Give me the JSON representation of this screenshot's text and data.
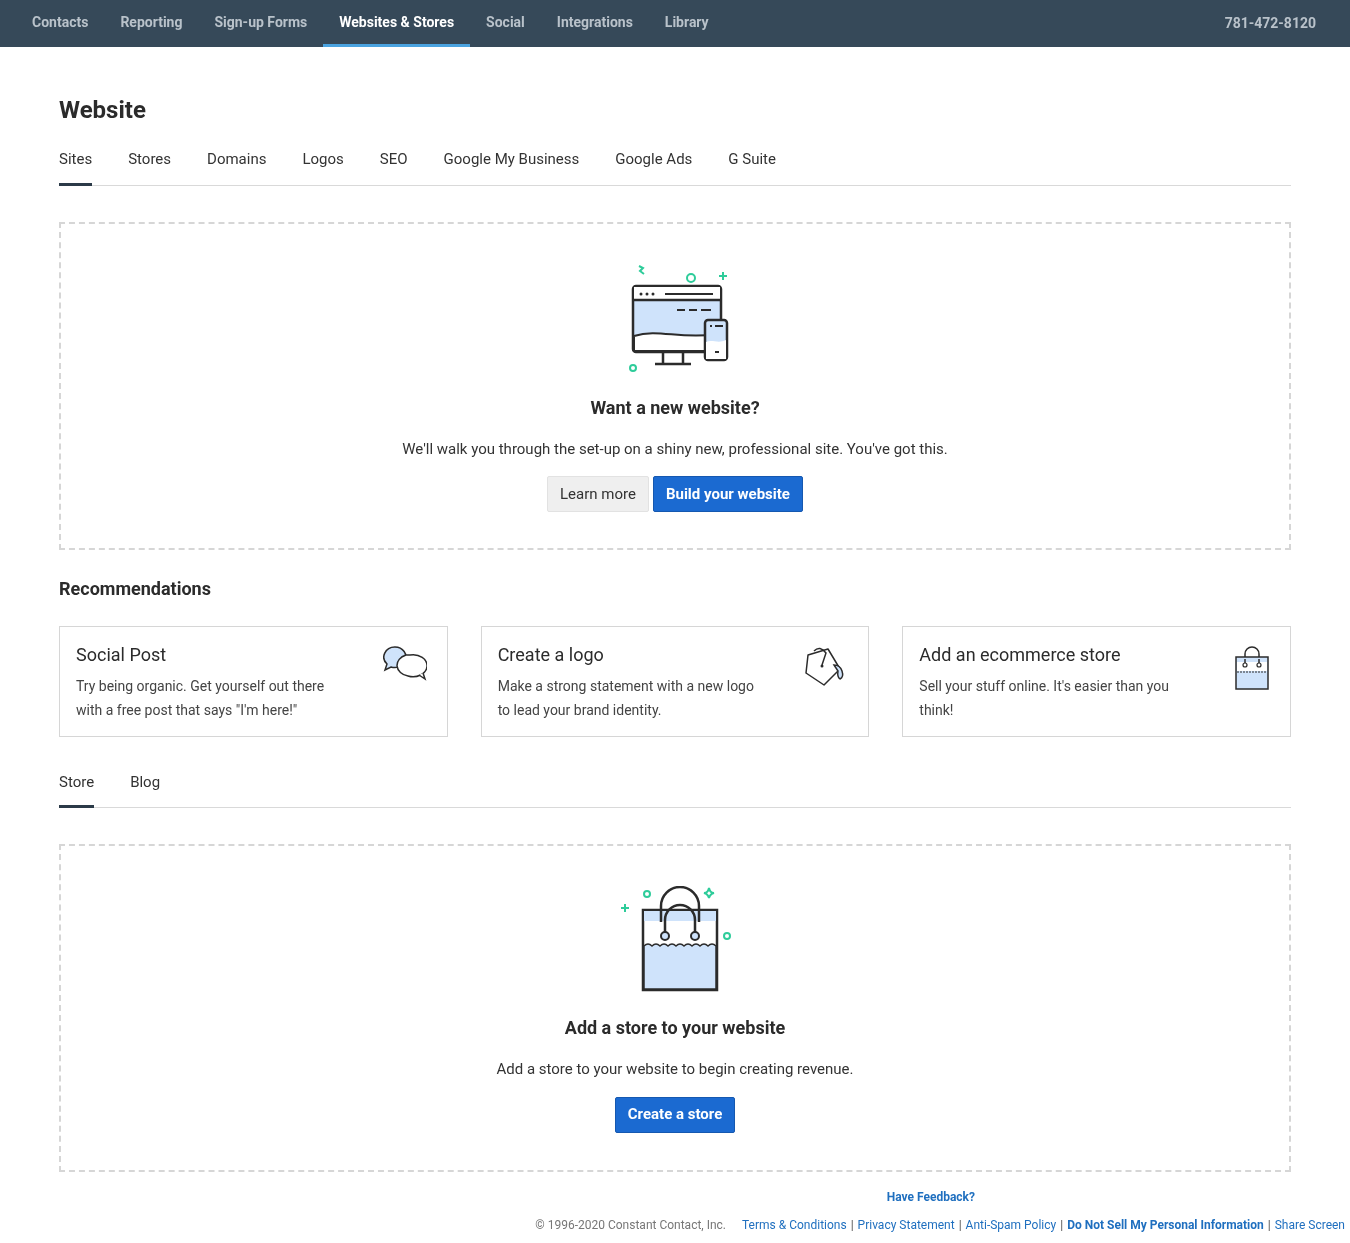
{
  "top_nav": {
    "items": [
      {
        "label": "Contacts",
        "selected": false
      },
      {
        "label": "Reporting",
        "selected": false
      },
      {
        "label": "Sign-up Forms",
        "selected": false
      },
      {
        "label": "Websites & Stores",
        "selected": true
      },
      {
        "label": "Social",
        "selected": false
      },
      {
        "label": "Integrations",
        "selected": false
      },
      {
        "label": "Library",
        "selected": false
      }
    ],
    "phone": "781-472-8120"
  },
  "page_title": "Website",
  "tabs": [
    {
      "label": "Sites",
      "selected": true
    },
    {
      "label": "Stores",
      "selected": false
    },
    {
      "label": "Domains",
      "selected": false
    },
    {
      "label": "Logos",
      "selected": false
    },
    {
      "label": "SEO",
      "selected": false
    },
    {
      "label": "Google My Business",
      "selected": false
    },
    {
      "label": "Google Ads",
      "selected": false
    },
    {
      "label": "G Suite",
      "selected": false
    }
  ],
  "website_panel": {
    "kind": "website",
    "heading": "Want a new website?",
    "text": "We'll walk you through the set-up on a shiny new, professional site. You've got this.",
    "buttons": [
      {
        "label": "Learn more",
        "kind": "secondary"
      },
      {
        "label": "Build your website",
        "kind": "primary"
      }
    ]
  },
  "recommendations": {
    "title": "Recommendations",
    "cards": [
      {
        "title": "Social Post",
        "text": "Try being organic. Get yourself out there with a free post that says \"I'm here!\"",
        "kind": "chat"
      },
      {
        "title": "Create a logo",
        "text": "Make a strong statement with a new logo to lead your brand identity.",
        "kind": "paint"
      },
      {
        "title": "Add an ecommerce store",
        "text": "Sell your stuff online. It's easier than you think!",
        "kind": "bag"
      }
    ]
  },
  "sub_tabs": [
    {
      "label": "Store",
      "selected": true
    },
    {
      "label": "Blog",
      "selected": false
    }
  ],
  "store_panel": {
    "kind": "store",
    "heading": "Add a store to your website",
    "text": "Add a store to your website to begin creating revenue.",
    "buttons": [
      {
        "label": "Create a store",
        "kind": "primary"
      }
    ]
  },
  "footer": {
    "feedback": "Have Feedback?",
    "copyright": "© 1996-2020 Constant Contact, Inc.",
    "separator": "|",
    "links": [
      {
        "label": "Terms & Conditions",
        "strong": false
      },
      {
        "label": "Privacy Statement",
        "strong": false
      },
      {
        "label": "Anti-Spam Policy",
        "strong": false
      },
      {
        "label": "Do Not Sell My Personal Information",
        "strong": true
      },
      {
        "label": "Share Screen",
        "strong": false
      }
    ]
  }
}
